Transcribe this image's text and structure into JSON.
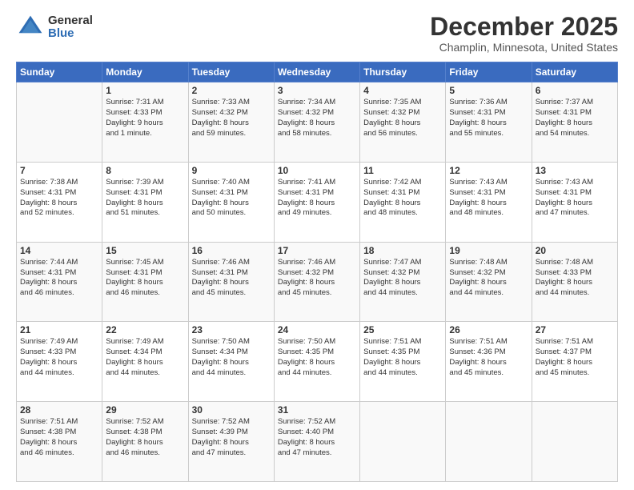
{
  "logo": {
    "general": "General",
    "blue": "Blue"
  },
  "title": "December 2025",
  "subtitle": "Champlin, Minnesota, United States",
  "weekdays": [
    "Sunday",
    "Monday",
    "Tuesday",
    "Wednesday",
    "Thursday",
    "Friday",
    "Saturday"
  ],
  "weeks": [
    [
      {
        "day": "",
        "info": ""
      },
      {
        "day": "1",
        "info": "Sunrise: 7:31 AM\nSunset: 4:33 PM\nDaylight: 9 hours\nand 1 minute."
      },
      {
        "day": "2",
        "info": "Sunrise: 7:33 AM\nSunset: 4:32 PM\nDaylight: 8 hours\nand 59 minutes."
      },
      {
        "day": "3",
        "info": "Sunrise: 7:34 AM\nSunset: 4:32 PM\nDaylight: 8 hours\nand 58 minutes."
      },
      {
        "day": "4",
        "info": "Sunrise: 7:35 AM\nSunset: 4:32 PM\nDaylight: 8 hours\nand 56 minutes."
      },
      {
        "day": "5",
        "info": "Sunrise: 7:36 AM\nSunset: 4:31 PM\nDaylight: 8 hours\nand 55 minutes."
      },
      {
        "day": "6",
        "info": "Sunrise: 7:37 AM\nSunset: 4:31 PM\nDaylight: 8 hours\nand 54 minutes."
      }
    ],
    [
      {
        "day": "7",
        "info": "Sunrise: 7:38 AM\nSunset: 4:31 PM\nDaylight: 8 hours\nand 52 minutes."
      },
      {
        "day": "8",
        "info": "Sunrise: 7:39 AM\nSunset: 4:31 PM\nDaylight: 8 hours\nand 51 minutes."
      },
      {
        "day": "9",
        "info": "Sunrise: 7:40 AM\nSunset: 4:31 PM\nDaylight: 8 hours\nand 50 minutes."
      },
      {
        "day": "10",
        "info": "Sunrise: 7:41 AM\nSunset: 4:31 PM\nDaylight: 8 hours\nand 49 minutes."
      },
      {
        "day": "11",
        "info": "Sunrise: 7:42 AM\nSunset: 4:31 PM\nDaylight: 8 hours\nand 48 minutes."
      },
      {
        "day": "12",
        "info": "Sunrise: 7:43 AM\nSunset: 4:31 PM\nDaylight: 8 hours\nand 48 minutes."
      },
      {
        "day": "13",
        "info": "Sunrise: 7:43 AM\nSunset: 4:31 PM\nDaylight: 8 hours\nand 47 minutes."
      }
    ],
    [
      {
        "day": "14",
        "info": "Sunrise: 7:44 AM\nSunset: 4:31 PM\nDaylight: 8 hours\nand 46 minutes."
      },
      {
        "day": "15",
        "info": "Sunrise: 7:45 AM\nSunset: 4:31 PM\nDaylight: 8 hours\nand 46 minutes."
      },
      {
        "day": "16",
        "info": "Sunrise: 7:46 AM\nSunset: 4:31 PM\nDaylight: 8 hours\nand 45 minutes."
      },
      {
        "day": "17",
        "info": "Sunrise: 7:46 AM\nSunset: 4:32 PM\nDaylight: 8 hours\nand 45 minutes."
      },
      {
        "day": "18",
        "info": "Sunrise: 7:47 AM\nSunset: 4:32 PM\nDaylight: 8 hours\nand 44 minutes."
      },
      {
        "day": "19",
        "info": "Sunrise: 7:48 AM\nSunset: 4:32 PM\nDaylight: 8 hours\nand 44 minutes."
      },
      {
        "day": "20",
        "info": "Sunrise: 7:48 AM\nSunset: 4:33 PM\nDaylight: 8 hours\nand 44 minutes."
      }
    ],
    [
      {
        "day": "21",
        "info": "Sunrise: 7:49 AM\nSunset: 4:33 PM\nDaylight: 8 hours\nand 44 minutes."
      },
      {
        "day": "22",
        "info": "Sunrise: 7:49 AM\nSunset: 4:34 PM\nDaylight: 8 hours\nand 44 minutes."
      },
      {
        "day": "23",
        "info": "Sunrise: 7:50 AM\nSunset: 4:34 PM\nDaylight: 8 hours\nand 44 minutes."
      },
      {
        "day": "24",
        "info": "Sunrise: 7:50 AM\nSunset: 4:35 PM\nDaylight: 8 hours\nand 44 minutes."
      },
      {
        "day": "25",
        "info": "Sunrise: 7:51 AM\nSunset: 4:35 PM\nDaylight: 8 hours\nand 44 minutes."
      },
      {
        "day": "26",
        "info": "Sunrise: 7:51 AM\nSunset: 4:36 PM\nDaylight: 8 hours\nand 45 minutes."
      },
      {
        "day": "27",
        "info": "Sunrise: 7:51 AM\nSunset: 4:37 PM\nDaylight: 8 hours\nand 45 minutes."
      }
    ],
    [
      {
        "day": "28",
        "info": "Sunrise: 7:51 AM\nSunset: 4:38 PM\nDaylight: 8 hours\nand 46 minutes."
      },
      {
        "day": "29",
        "info": "Sunrise: 7:52 AM\nSunset: 4:38 PM\nDaylight: 8 hours\nand 46 minutes."
      },
      {
        "day": "30",
        "info": "Sunrise: 7:52 AM\nSunset: 4:39 PM\nDaylight: 8 hours\nand 47 minutes."
      },
      {
        "day": "31",
        "info": "Sunrise: 7:52 AM\nSunset: 4:40 PM\nDaylight: 8 hours\nand 47 minutes."
      },
      {
        "day": "",
        "info": ""
      },
      {
        "day": "",
        "info": ""
      },
      {
        "day": "",
        "info": ""
      }
    ]
  ]
}
